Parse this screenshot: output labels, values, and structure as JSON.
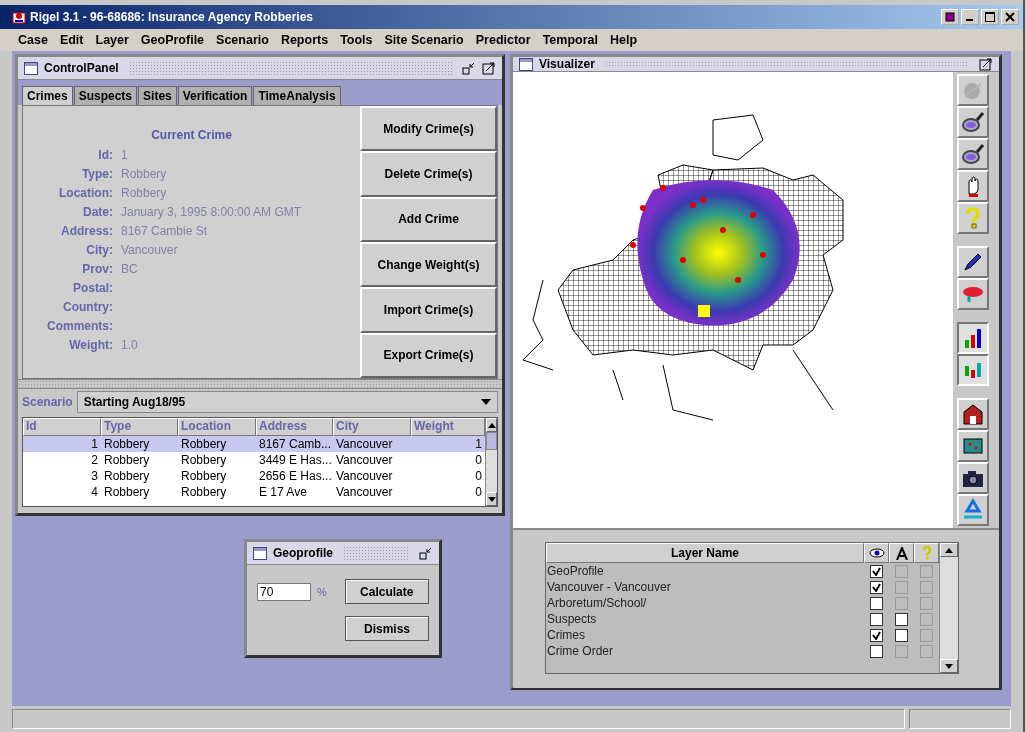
{
  "window": {
    "title": "Rigel 3.1 - 96-68686: Insurance Agency Robberies"
  },
  "menu": [
    "Case",
    "Edit",
    "Layer",
    "GeoProfile",
    "Scenario",
    "Reports",
    "Tools",
    "Site Scenario",
    "Predictor",
    "Temporal",
    "Help"
  ],
  "control_panel": {
    "title": "ControlPanel",
    "tabs": [
      {
        "label": "Crimes",
        "selected": true
      },
      {
        "label": "Suspects",
        "selected": false
      },
      {
        "label": "Sites",
        "selected": false
      },
      {
        "label": "Verification",
        "selected": false
      },
      {
        "label": "TimeAnalysis",
        "selected": false
      }
    ],
    "current_crime": {
      "heading": "Current Crime",
      "fields": [
        {
          "label": "Id:",
          "value": "1"
        },
        {
          "label": "Type:",
          "value": "Robbery"
        },
        {
          "label": "Location:",
          "value": "Robbery"
        },
        {
          "label": "Date:",
          "value": "January 3, 1995 8:00:00 AM GMT"
        },
        {
          "label": "Address:",
          "value": "8167 Cambie St"
        },
        {
          "label": "City:",
          "value": "Vancouver"
        },
        {
          "label": "Prov:",
          "value": "BC"
        },
        {
          "label": "Postal:"
        },
        {
          "label": "Country:"
        },
        {
          "label": "Comments:"
        },
        {
          "label": "Weight:",
          "value": "1.0"
        }
      ]
    },
    "buttons": [
      "Modify Crime(s)",
      "Delete Crime(s)",
      "Add Crime",
      "Change Weight(s)",
      "Import Crime(s)",
      "Export Crime(s)"
    ],
    "scenario": {
      "label": "Scenario",
      "value": "Starting Aug18/95"
    },
    "table": {
      "columns": [
        "Id",
        "Type",
        "Location",
        "Address",
        "City",
        "Weight"
      ],
      "rows": [
        {
          "cells": [
            "1",
            "Robbery",
            "Robbery",
            "8167 Camb...",
            "Vancouver",
            "1"
          ],
          "selected": true
        },
        {
          "cells": [
            "2",
            "Robbery",
            "Robbery",
            "3449 E Has...",
            "Vancouver",
            "0"
          ],
          "selected": false
        },
        {
          "cells": [
            "3",
            "Robbery",
            "Robbery",
            "2656 E Has...",
            "Vancouver",
            "0"
          ],
          "selected": false
        },
        {
          "cells": [
            "4",
            "Robbery",
            "Robbery",
            "E 17 Ave",
            "Vancouver",
            "0"
          ],
          "selected": false
        }
      ]
    }
  },
  "geoprofile_dialog": {
    "title": "Geoprofile",
    "value": "70",
    "unit": "%",
    "buttons": [
      "Calculate",
      "Dismiss"
    ]
  },
  "visualizer": {
    "title": "Visualizer",
    "toolbar": [
      [
        {
          "disabled": true,
          "selected": false
        },
        {
          "disabled": false,
          "selected": false
        },
        {
          "disabled": false,
          "selected": false
        },
        {
          "disabled": false,
          "selected": false
        },
        {
          "disabled": false,
          "selected": false
        }
      ],
      [
        {
          "disabled": false,
          "selected": false
        },
        {
          "disabled": false,
          "selected": false
        }
      ],
      [
        {
          "disabled": false,
          "selected": true
        },
        {
          "disabled": false,
          "selected": true
        }
      ],
      [
        {
          "disabled": false,
          "selected": false
        },
        {
          "disabled": false,
          "selected": false
        },
        {
          "disabled": false,
          "selected": false
        },
        {
          "disabled": false,
          "selected": false
        }
      ]
    ],
    "layers": {
      "column": "Layer Name",
      "rows": [
        {
          "name": "GeoProfile",
          "checks": [
            {
              "checked": true,
              "disabled": false
            },
            {
              "checked": false,
              "disabled": true
            },
            {
              "checked": false,
              "disabled": true
            }
          ]
        },
        {
          "name": "Vancouver - Vancouver",
          "checks": [
            {
              "checked": true,
              "disabled": false
            },
            {
              "checked": false,
              "disabled": true
            },
            {
              "checked": false,
              "disabled": true
            }
          ]
        },
        {
          "name": "Arboretum/School/",
          "checks": [
            {
              "checked": false,
              "disabled": false
            },
            {
              "checked": false,
              "disabled": true
            },
            {
              "checked": false,
              "disabled": true
            }
          ]
        },
        {
          "name": "Suspects",
          "checks": [
            {
              "checked": false,
              "disabled": false
            },
            {
              "checked": false,
              "disabled": false
            },
            {
              "checked": false,
              "disabled": true
            }
          ]
        },
        {
          "name": "Crimes",
          "checks": [
            {
              "checked": true,
              "disabled": false
            },
            {
              "checked": false,
              "disabled": false
            },
            {
              "checked": false,
              "disabled": true
            }
          ]
        },
        {
          "name": "Crime Order",
          "checks": [
            {
              "checked": false,
              "disabled": false
            },
            {
              "checked": false,
              "disabled": true
            },
            {
              "checked": false,
              "disabled": true
            }
          ]
        }
      ]
    }
  }
}
